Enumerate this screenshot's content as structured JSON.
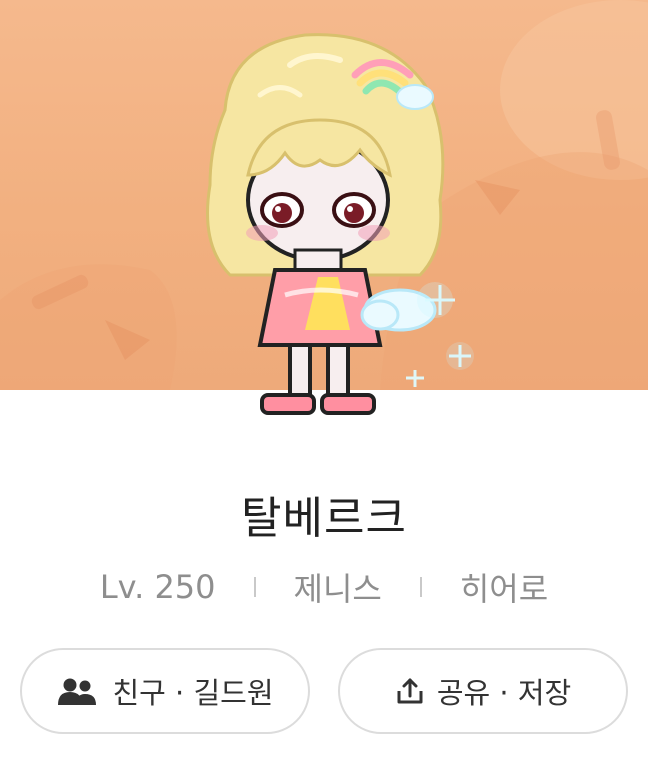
{
  "character": {
    "name": "탈베르크",
    "level": "Lv. 250",
    "world": "제니스",
    "job": "히어로"
  },
  "actions": {
    "friends_label": "친구 · 길드원",
    "share_label": "공유 · 저장"
  },
  "colors": {
    "banner_bg": "#f2b080",
    "text_primary": "#222222",
    "text_secondary": "#8e8e8e",
    "button_border": "#dcdcdc"
  },
  "icons": {
    "friends": "people-icon",
    "share": "share-upload-icon"
  }
}
